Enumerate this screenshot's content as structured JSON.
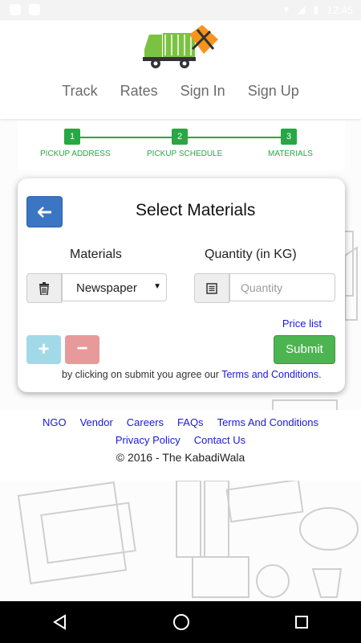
{
  "status_bar": {
    "time": "12:45"
  },
  "nav": {
    "track": "Track",
    "rates": "Rates",
    "sign_in": "Sign In",
    "sign_up": "Sign Up"
  },
  "stepper": {
    "steps": [
      {
        "number": "1",
        "label": "PICKUP ADDRESS"
      },
      {
        "number": "2",
        "label": "PICKUP SCHEDULE"
      },
      {
        "number": "3",
        "label": "MATERIALS"
      }
    ]
  },
  "form": {
    "title": "Select Materials",
    "materials_label": "Materials",
    "quantity_label": "Quantity (in KG)",
    "material_selected": "Newspaper",
    "quantity_placeholder": "Quantity",
    "price_list": "Price list",
    "add_label": "+",
    "remove_label": "−",
    "submit_label": "Submit",
    "agree_text": "by clicking on submit you agree our",
    "terms_link": "Terms and Conditions."
  },
  "footer": {
    "links_row1": [
      "NGO",
      "Vendor",
      "Careers",
      "FAQs",
      "Terms And Conditions"
    ],
    "links_row2": [
      "Privacy Policy",
      "Contact Us"
    ],
    "copyright": "© 2016 - The KabadiWala"
  },
  "colors": {
    "accent_green": "#28a745",
    "primary_blue": "#3a76c4",
    "link_blue": "#1a1ad6",
    "submit_green": "#4cb451"
  },
  "icons": [
    "trash-icon",
    "list-icon",
    "arrow-left-icon",
    "back-triangle-icon",
    "home-circle-icon",
    "recents-square-icon"
  ]
}
